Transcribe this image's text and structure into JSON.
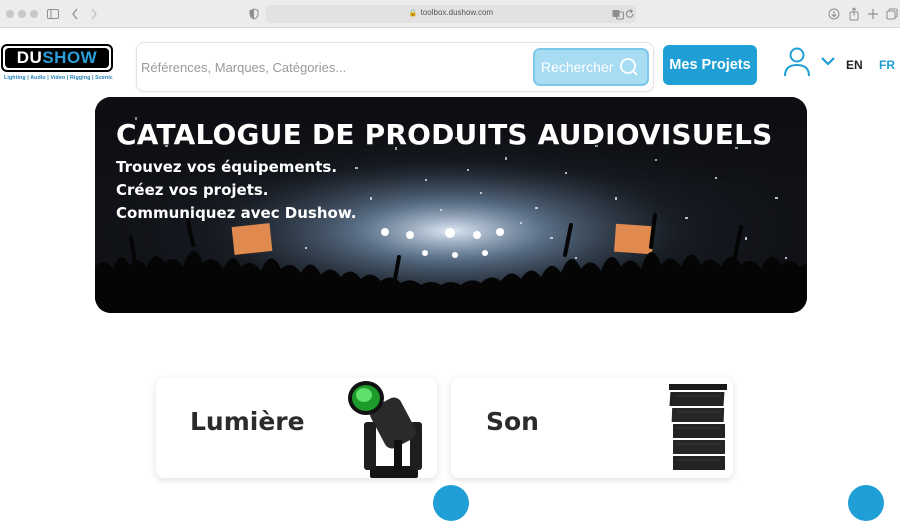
{
  "browser": {
    "url": "toolbox.dushow.com",
    "icons": [
      "traffic-light",
      "sidebar-icon",
      "back-icon",
      "forward-icon",
      "shield-icon",
      "lock-icon",
      "translate-icon",
      "reload-icon",
      "download-icon",
      "share-icon",
      "new-tab-icon",
      "tabs-icon"
    ]
  },
  "header": {
    "logo": {
      "du": "DU",
      "show": "SHOW",
      "tagline": "Lighting | Audio | Video | Rigging | Scenic"
    },
    "search": {
      "placeholder": "Références, Marques, Catégories...",
      "button_label": "Rechercher"
    },
    "projects_button": "Mes Projets",
    "languages": [
      {
        "code": "EN",
        "active": false
      },
      {
        "code": "FR",
        "active": true
      }
    ]
  },
  "banner": {
    "title": "CATALOGUE DE PRODUITS AUDIOVISUELS",
    "lines": [
      "Trouvez vos équipements.",
      "Créez vos projets.",
      "Communiquez avec Dushow."
    ]
  },
  "categories": [
    {
      "label": "Lumière",
      "image": "moving-head-light-icon"
    },
    {
      "label": "Son",
      "image": "line-array-speaker-icon"
    }
  ],
  "colors": {
    "accent": "#1f9fd6",
    "search_button": "#a8dcf2",
    "text_dark": "#2b2b2b"
  }
}
